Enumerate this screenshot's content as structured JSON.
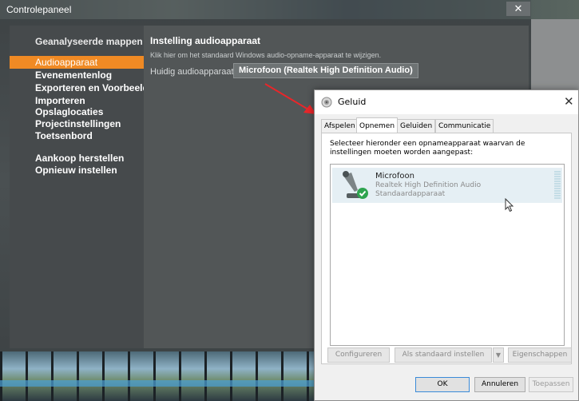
{
  "control_panel": {
    "title": "Controlepaneel",
    "close_glyph": "✕",
    "sidebar": {
      "items": [
        {
          "label": "Geanalyseerde mappen"
        },
        {
          "label": "Audioapparaat"
        },
        {
          "label": "Evenementenlog"
        },
        {
          "label": "Exporteren en Voorbeeld"
        },
        {
          "label": "Importeren"
        },
        {
          "label": "Opslaglocaties"
        },
        {
          "label": "Projectinstellingen"
        },
        {
          "label": "Toetsenbord"
        },
        {
          "label": "Aankoop herstellen"
        },
        {
          "label": "Opnieuw instellen"
        }
      ],
      "active_index": 1
    },
    "main": {
      "heading": "Instelling audioapparaat",
      "subtext": "Klik hier om het standaard Windows audio-opname-apparaat te wijzigen.",
      "current_label": "Huidig audioapparaat:",
      "current_device": "Microfoon (Realtek High Definition Audio)"
    },
    "accent_color": "#f08a24"
  },
  "sound_dialog": {
    "title": "Geluid",
    "close_glyph": "✕",
    "tabs": [
      {
        "label": "Afspelen"
      },
      {
        "label": "Opnemen"
      },
      {
        "label": "Geluiden"
      },
      {
        "label": "Communicatie"
      }
    ],
    "active_tab": 1,
    "description": "Selecteer hieronder een opnameapparaat waarvan de instellingen moeten worden aangepast:",
    "devices": [
      {
        "name": "Microfoon",
        "driver": "Realtek High Definition Audio",
        "status": "Standaardapparaat",
        "icon": "microphone-icon",
        "badge": "check-icon"
      }
    ],
    "panel_buttons": {
      "configure": "Configureren",
      "set_default": "Als standaard instellen",
      "dropdown": "▼",
      "properties": "Eigenschappen"
    },
    "footer_buttons": {
      "ok": "OK",
      "cancel": "Annuleren",
      "apply": "Toepassen"
    }
  },
  "annotation_arrow_color": "#e8262a"
}
